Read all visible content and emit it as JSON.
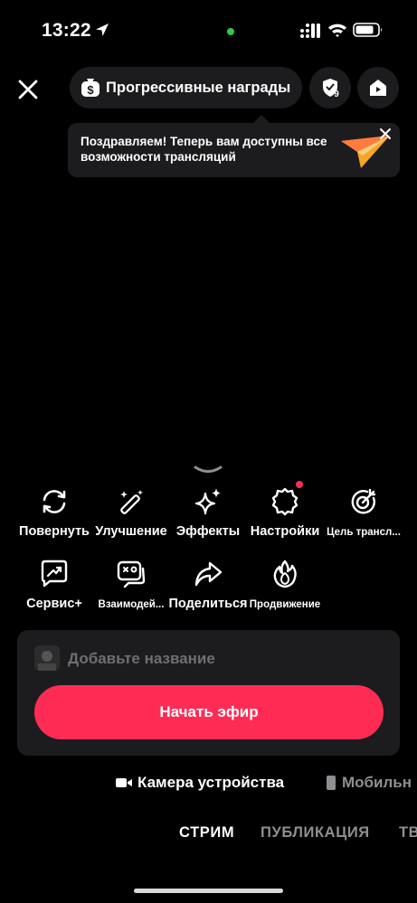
{
  "status_bar": {
    "time": "13:22",
    "icons": [
      "location-arrow-icon",
      "signal-icon",
      "wifi-icon",
      "battery-icon"
    ],
    "indicator_color": "#2ecc40"
  },
  "top_bar": {
    "close_icon": "close-icon",
    "rewards_label": "Прогрессивные награды",
    "rewards_icon": "money-bag-icon",
    "shield_badge": "9",
    "home_icon": "home-icon"
  },
  "tooltip": {
    "text": "Поздравляем! Теперь вам доступны все возможности трансляций",
    "icon": "paper-plane-icon"
  },
  "tools": [
    {
      "label": "Повернуть",
      "icon": "rotate-icon"
    },
    {
      "label": "Улучшение",
      "icon": "magic-wand-icon"
    },
    {
      "label": "Эффекты",
      "icon": "sparkles-icon"
    },
    {
      "label": "Настройки",
      "icon": "gear-icon",
      "has_notification": true
    },
    {
      "label": "Цель трансл...",
      "icon": "target-icon"
    },
    {
      "label": "Сервис+",
      "icon": "chart-chat-icon"
    },
    {
      "label": "Взаимодей...",
      "icon": "interaction-icon"
    },
    {
      "label": "Поделиться",
      "icon": "share-icon"
    },
    {
      "label": "Продвижение",
      "icon": "flame-icon"
    }
  ],
  "card": {
    "title_placeholder": "Добавьте название",
    "go_live_label": "Начать эфир"
  },
  "sources": {
    "camera": "Камера устройства",
    "mobile": "Мобильн"
  },
  "modes": {
    "stream": "СТРИМ",
    "post": "ПУБЛИКАЦИЯ",
    "other": "ТВ"
  },
  "colors": {
    "accent": "#fe2c55",
    "surface": "#1c1c1e",
    "muted": "#8e8e93"
  }
}
